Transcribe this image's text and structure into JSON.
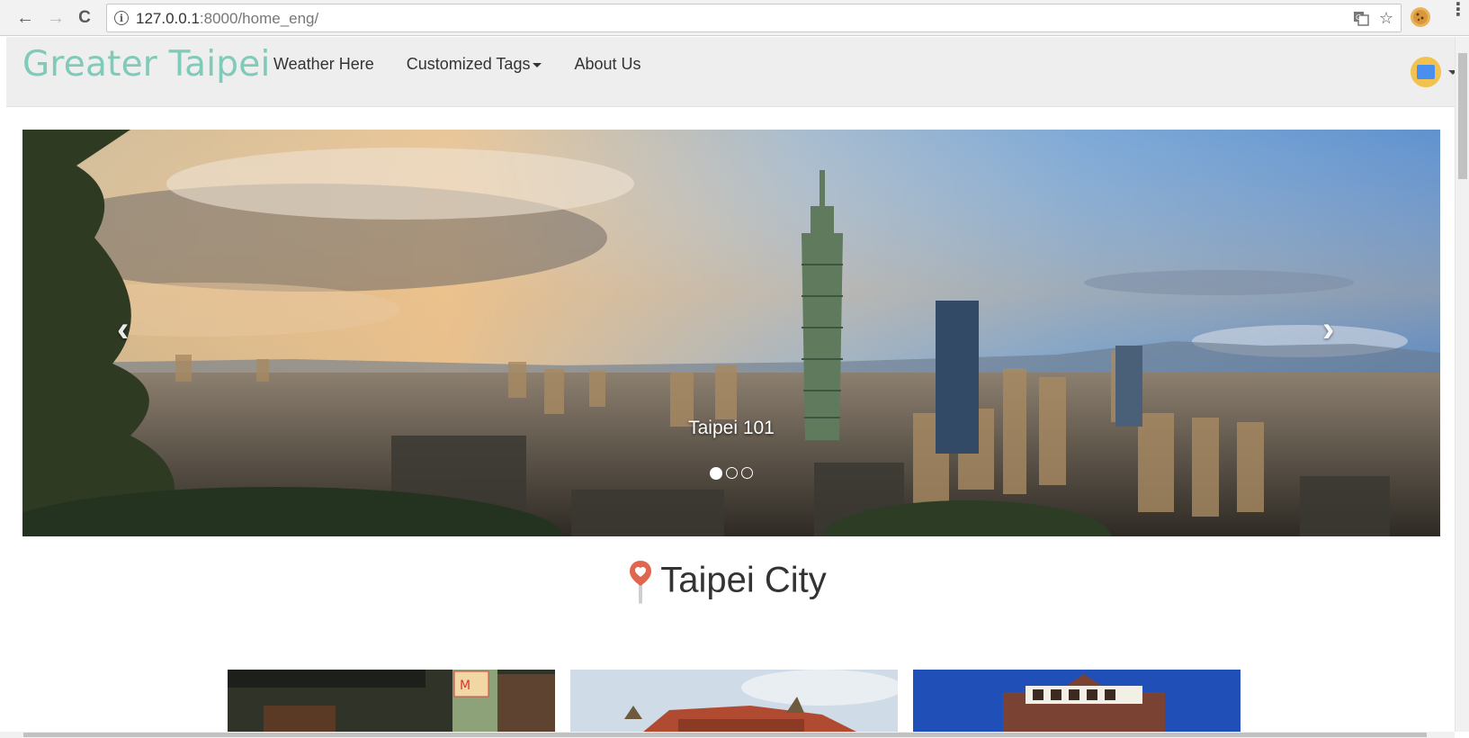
{
  "browser": {
    "url_host": "127.0.0.1",
    "url_rest": ":8000/home_eng/",
    "back_glyph": "←",
    "forward_glyph": "→",
    "reload_glyph": "C",
    "star_glyph": "☆",
    "menu_glyph": "⋮"
  },
  "navbar": {
    "brand": "Greater Taipei",
    "links": [
      "Weather Here",
      "Customized Tags",
      "About Us"
    ]
  },
  "carousel": {
    "caption": "Taipei 101",
    "prev_glyph": "‹",
    "next_glyph": "›",
    "slide_count": 3,
    "active_index": 0
  },
  "section": {
    "title": "Taipei City",
    "pin_color": "#e0664f"
  },
  "colors": {
    "brand": "#7fcab9",
    "navbar_bg": "#eeeeee"
  }
}
